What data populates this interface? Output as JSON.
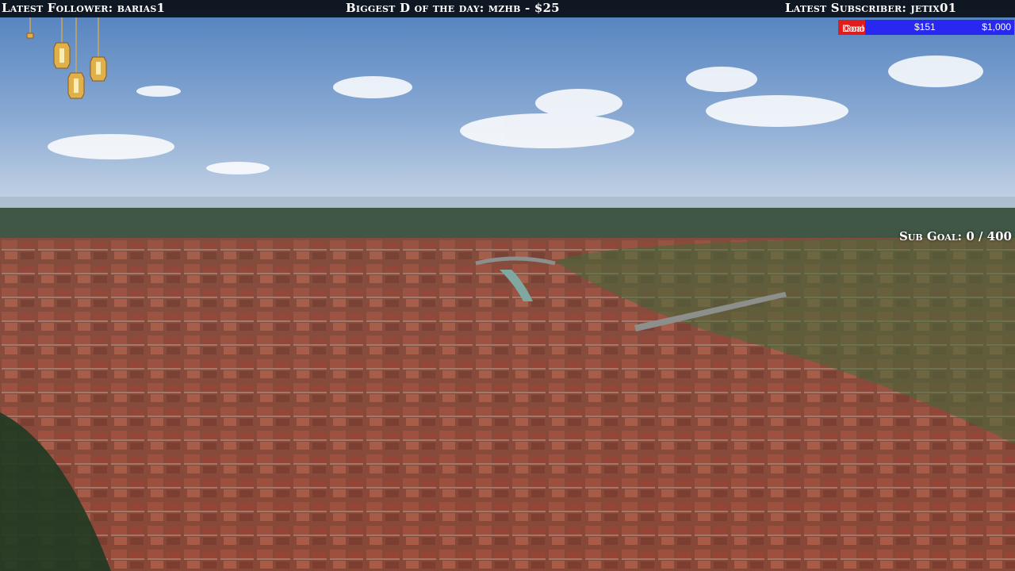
{
  "header": {
    "latest_follower": "Latest Follower: barias1",
    "biggest_donation": "Biggest D of the day: mzhb - $25",
    "latest_subscriber": "Latest Subscriber: jetix01"
  },
  "donation_goal": {
    "label_dono": "Dono",
    "label_goal": "Goal",
    "current": "$151",
    "target": "$1,000",
    "progress_fraction": 0.151,
    "fill_color": "#e01d1d",
    "bar_color": "#2828f0"
  },
  "sub_goal": {
    "text": "Sub Goal: 0 / 400"
  },
  "overlay": {
    "decoration_icon": "hanging-lanterns-icon",
    "background": "aerial-city-view"
  }
}
